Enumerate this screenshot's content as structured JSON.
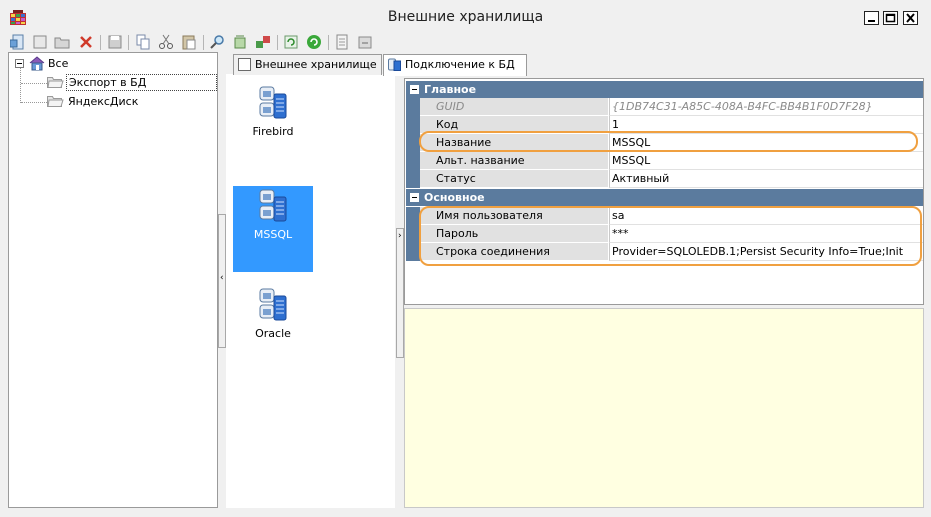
{
  "window": {
    "title": "Внешние хранилища"
  },
  "toolbar": {
    "icons": [
      "add-icon",
      "new-icon",
      "open-folder-icon",
      "delete-icon",
      "save-icon",
      "copy-icon",
      "cut-icon",
      "paste-icon",
      "search-icon",
      "filter-icon",
      "connect-icon",
      "refresh-icon",
      "sync-icon",
      "properties-icon",
      "export-icon"
    ]
  },
  "tree": {
    "root_label": "Все",
    "items": [
      {
        "label": "Экспорт в БД",
        "selected": true
      },
      {
        "label": "ЯндексДиск",
        "selected": false
      }
    ]
  },
  "iconlist": {
    "items": [
      {
        "label": "Firebird",
        "selected": false
      },
      {
        "label": "MSSQL",
        "selected": true
      },
      {
        "label": "Oracle",
        "selected": false
      }
    ]
  },
  "tabs": [
    {
      "label": "Внешнее хранилище",
      "active": false
    },
    {
      "label": "Подключение к БД",
      "active": true
    }
  ],
  "properties": {
    "categories": [
      {
        "name": "Главное",
        "rows": [
          {
            "name": "GUID",
            "value": "{1DB74C31-A85C-408A-B4FC-BB4B1F0D7F28}",
            "readonly": true
          },
          {
            "name": "Код",
            "value": "1",
            "readonly": false
          },
          {
            "name": "Название",
            "value": "MSSQL",
            "readonly": false
          },
          {
            "name": "Альт. название",
            "value": "MSSQL",
            "readonly": false
          },
          {
            "name": "Статус",
            "value": "Активный",
            "readonly": false
          }
        ]
      },
      {
        "name": "Основное",
        "rows": [
          {
            "name": "Имя пользователя",
            "value": "sa",
            "readonly": false
          },
          {
            "name": "Пароль",
            "value": "***",
            "readonly": false
          },
          {
            "name": "Строка соединения",
            "value": "Provider=SQLOLEDB.1;Persist Security Info=True;Init",
            "readonly": false
          }
        ]
      }
    ]
  },
  "colors": {
    "category_header": "#5b7b9e",
    "selection": "#3399ff",
    "highlight": "#f0a040",
    "description_bg": "#ffffe1"
  }
}
